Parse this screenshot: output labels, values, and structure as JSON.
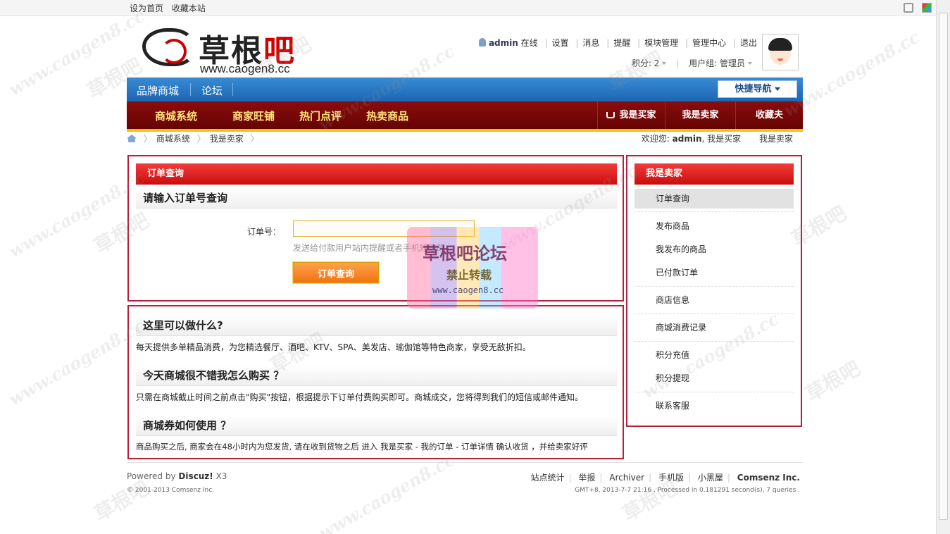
{
  "topbar": {
    "links": [
      "设为首页",
      "收藏本站"
    ],
    "icons": [
      "expand-icon",
      "skin-icon"
    ]
  },
  "logo": {
    "name_black": "草根",
    "name_red": "吧",
    "site": "www.caogen8.cc"
  },
  "user": {
    "name": "admin",
    "status": "在线",
    "links": [
      "设置",
      "消息",
      "提醒",
      "模块管理",
      "管理中心",
      "退出"
    ],
    "credits": "积分: 2",
    "group": "用户组: 管理员"
  },
  "bluenav": {
    "items": [
      "品牌商城",
      "论坛"
    ],
    "quick_nav": "快捷导航"
  },
  "rednav": {
    "items": [
      "商城系统",
      "商家旺铺",
      "热门点评",
      "热卖商品"
    ],
    "right_items": [
      "我是买家",
      "我是卖家",
      "收藏夫"
    ]
  },
  "breadcrumb": {
    "items": [
      "商城系统",
      "我是卖家"
    ],
    "welcome_prefix": "欢迎您:",
    "welcome_user": "admin",
    "welcome_role": ", 我是买家",
    "welcome_extra": "我是卖家"
  },
  "order_panel": {
    "title": "订单查询",
    "subtitle": "请输入订单号查询",
    "label": "订单号：",
    "input_value": "",
    "input_placeholder": "",
    "hint": "发送给付款用户站内提醒或者手机短信的",
    "button": "订单查询"
  },
  "faq": [
    {
      "q": "这里可以做什么?",
      "a": "每天提供多单精品消费，为您精选餐厅、酒吧、KTV、SPA、美发店、瑜伽馆等特色商家，享受无敌折扣。"
    },
    {
      "q": "今天商城很不错我怎么购买 ？",
      "a": "只需在商城截止时间之前点击\"购买\"按钮，根据提示下订单付费购买即可。商城成交，您将得到我们的短信或邮件通知。"
    },
    {
      "q": "商城券如何使用 ？",
      "a": "商品购买之后, 商家会在48小时内为您发货, 请在收到货物之后  进入  我是买家  - 我的订单  - 订单详情  确认收货 ，并给卖家好评"
    }
  ],
  "seller_menu": {
    "title": "我是卖家",
    "items": [
      "订单查询",
      "发布商品",
      "我发布的商品",
      "已付款订单",
      "商店信息",
      "商城消费记录",
      "积分充值",
      "积分提现",
      "联系客服"
    ]
  },
  "footer": {
    "powered_prefix": "Powered by",
    "powered_name": "Discuz!",
    "powered_ver": "X3",
    "copyright": "© 2001-2013 Comsenz Inc.",
    "links": [
      "站点统计",
      "举报",
      "Archiver",
      "手机版",
      "小黑屋"
    ],
    "company": "Comsenz Inc.",
    "stats": "GMT+8, 2013-7-7 21:16 , Processed in 0.181291 second(s), 7 queries ."
  },
  "watermark": {
    "title": "草根吧论坛",
    "notice": "禁止转载",
    "url": "www.caogen8.cc",
    "tile_brand": "草根吧",
    "tile_url": "www.caogen8.cc"
  }
}
